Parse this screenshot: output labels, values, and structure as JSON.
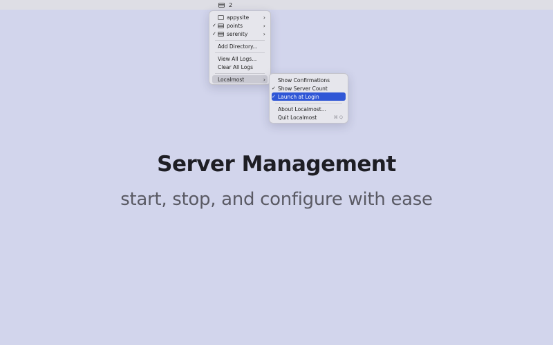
{
  "colors": {
    "background": "#d2d5ec",
    "menubar": "#dedee5",
    "menu_bg": "#e6e6ec",
    "selected": "#2f56d6",
    "submenu_open": "#c9c9d2",
    "title": "#1e1e24",
    "subtitle": "#5a5a64"
  },
  "menubar": {
    "status_icon": "server-stack-icon",
    "server_count": "2"
  },
  "main_menu": {
    "servers": [
      {
        "name": "appysite",
        "checked": false,
        "icon": "folder-outline-icon"
      },
      {
        "name": "points",
        "checked": true,
        "icon": "server-stack-icon"
      },
      {
        "name": "serenity",
        "checked": true,
        "icon": "server-stack-icon"
      }
    ],
    "add_directory": "Add Directory...",
    "view_all_logs": "View All Logs...",
    "clear_all_logs": "Clear All Logs",
    "app_item": "Localmost"
  },
  "sub_menu": {
    "show_confirmations": "Show Confirmations",
    "show_server_count": "Show Server Count",
    "launch_at_login": "Launch at Login",
    "about": "About Localmost...",
    "quit": "Quit Localmost",
    "quit_shortcut": "⌘ Q",
    "check_mark": "✓"
  },
  "hero": {
    "title": "Server Management",
    "subtitle": "start, stop, and configure with ease"
  }
}
